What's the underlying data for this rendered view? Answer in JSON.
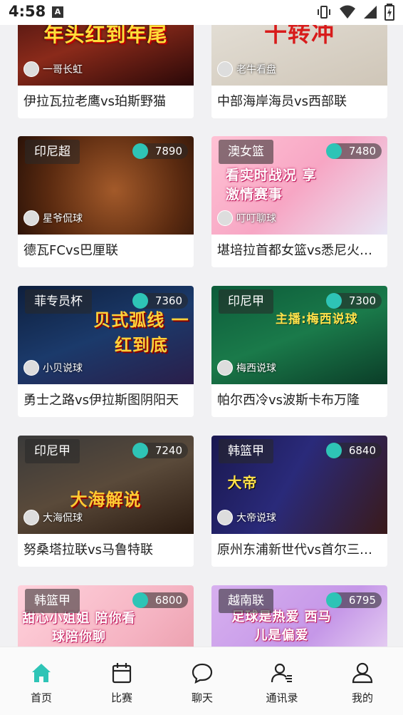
{
  "status_bar": {
    "time": "4:58",
    "a_icon": "A"
  },
  "accent_color": "#2ec4b6",
  "cards": [
    {
      "league": "",
      "viewers": "",
      "anchor": "一哥长虹",
      "title": "伊拉瓦拉老鹰vs珀斯野猫",
      "art_text": "年头红到年尾"
    },
    {
      "league": "",
      "viewers": "",
      "anchor": "老牛看盘",
      "title": "中部海岸海员vs西部联",
      "art_text": "十转冲"
    },
    {
      "league": "印尼超",
      "viewers": "7890",
      "anchor": "星爷侃球",
      "title": "德瓦FCvs巴厘联",
      "art_text": ""
    },
    {
      "league": "澳女篮",
      "viewers": "7480",
      "anchor": "叮叮聊球",
      "title": "堪培拉首都女篮vs悉尼火…",
      "art_text": "看实时战况 享激情赛事"
    },
    {
      "league": "菲专员杯",
      "viewers": "7360",
      "anchor": "小贝说球",
      "title": "勇士之路vs伊拉斯图阴阳天",
      "art_text": "贝式弧线 一红到底"
    },
    {
      "league": "印尼甲",
      "viewers": "7300",
      "anchor": "梅西说球",
      "title": "帕尔西冷vs波斯卡布万隆",
      "art_text": "主播:梅西说球"
    },
    {
      "league": "印尼甲",
      "viewers": "7240",
      "anchor": "大海侃球",
      "title": "努桑塔拉联vs马鲁特联",
      "art_text": "大海解说"
    },
    {
      "league": "韩篮甲",
      "viewers": "6840",
      "anchor": "大帝说球",
      "title": "原州东浦新世代vs首尔三…",
      "art_text": "大帝"
    },
    {
      "league": "韩篮甲",
      "viewers": "6800",
      "anchor": "",
      "title": "",
      "art_text": "甜心小姐姐 陪你看球陪你聊"
    },
    {
      "league": "越南联",
      "viewers": "6795",
      "anchor": "",
      "title": "",
      "art_text": "足球是热爱 西马儿是偏爱"
    }
  ],
  "tabs": [
    {
      "label": "首页",
      "icon": "home-icon",
      "active": true
    },
    {
      "label": "比赛",
      "icon": "calendar-icon",
      "active": false
    },
    {
      "label": "聊天",
      "icon": "chat-icon",
      "active": false
    },
    {
      "label": "通讯录",
      "icon": "contacts-icon",
      "active": false
    },
    {
      "label": "我的",
      "icon": "profile-icon",
      "active": false
    }
  ]
}
